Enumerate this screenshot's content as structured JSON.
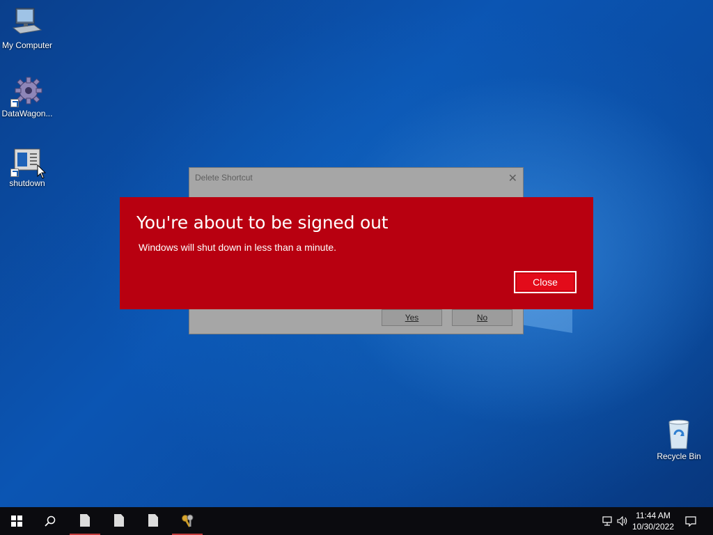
{
  "desktop": {
    "icons": [
      {
        "label": "My Computer",
        "icon": "computer-icon"
      },
      {
        "label": "DataWagon...",
        "icon": "gear-icon"
      },
      {
        "label": "shutdown",
        "icon": "window-icon"
      }
    ],
    "recycle_bin": {
      "label": "Recycle Bin",
      "icon": "recycle-bin-icon"
    }
  },
  "background_dialog": {
    "title": "Delete Shortcut",
    "close_glyph": "✕",
    "buttons": {
      "yes": "Yes",
      "no": "No"
    }
  },
  "signout_banner": {
    "title": "You're about to be signed out",
    "message": "Windows will shut down in less than a minute.",
    "close_label": "Close",
    "color": "#b80010"
  },
  "taskbar": {
    "time": "11:44 AM",
    "date": "10/30/2022",
    "items": [
      {
        "icon": "windows-start-icon"
      },
      {
        "icon": "search-icon"
      },
      {
        "icon": "file-icon",
        "active": true
      },
      {
        "icon": "file-icon",
        "active": false
      },
      {
        "icon": "file-icon",
        "active": false
      },
      {
        "icon": "keys-icon",
        "active": true
      }
    ]
  }
}
